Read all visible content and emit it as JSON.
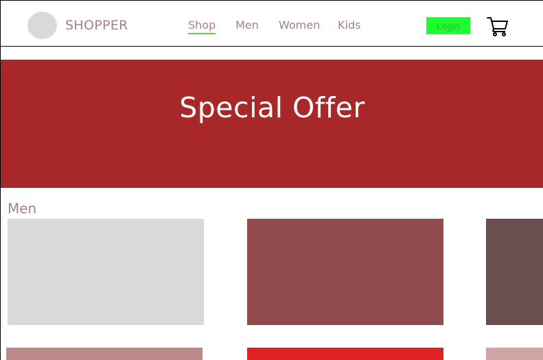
{
  "header": {
    "brand": "SHOPPER",
    "nav": [
      {
        "label": "Shop",
        "active": true
      },
      {
        "label": "Men",
        "active": false
      },
      {
        "label": "Women",
        "active": false
      },
      {
        "label": "Kids",
        "active": false
      }
    ],
    "login_label": "Login",
    "cart_icon": "shopping-cart-icon"
  },
  "banner": {
    "title": "Special Offer",
    "color": "#a8282a"
  },
  "section": {
    "title": "Men",
    "cards_row1": [
      {
        "color": "#d9d9d9"
      },
      {
        "color": "#924b4c"
      },
      {
        "color": "#6b4e4f"
      }
    ],
    "cards_row2": [
      {
        "color": "#bb8a89"
      },
      {
        "color": "#e02224"
      },
      {
        "color": "#d0a4a5"
      }
    ]
  },
  "colors": {
    "accent_text": "#a88282",
    "login_bg": "#1aff2d",
    "active_underline": "#5fcf3f"
  }
}
